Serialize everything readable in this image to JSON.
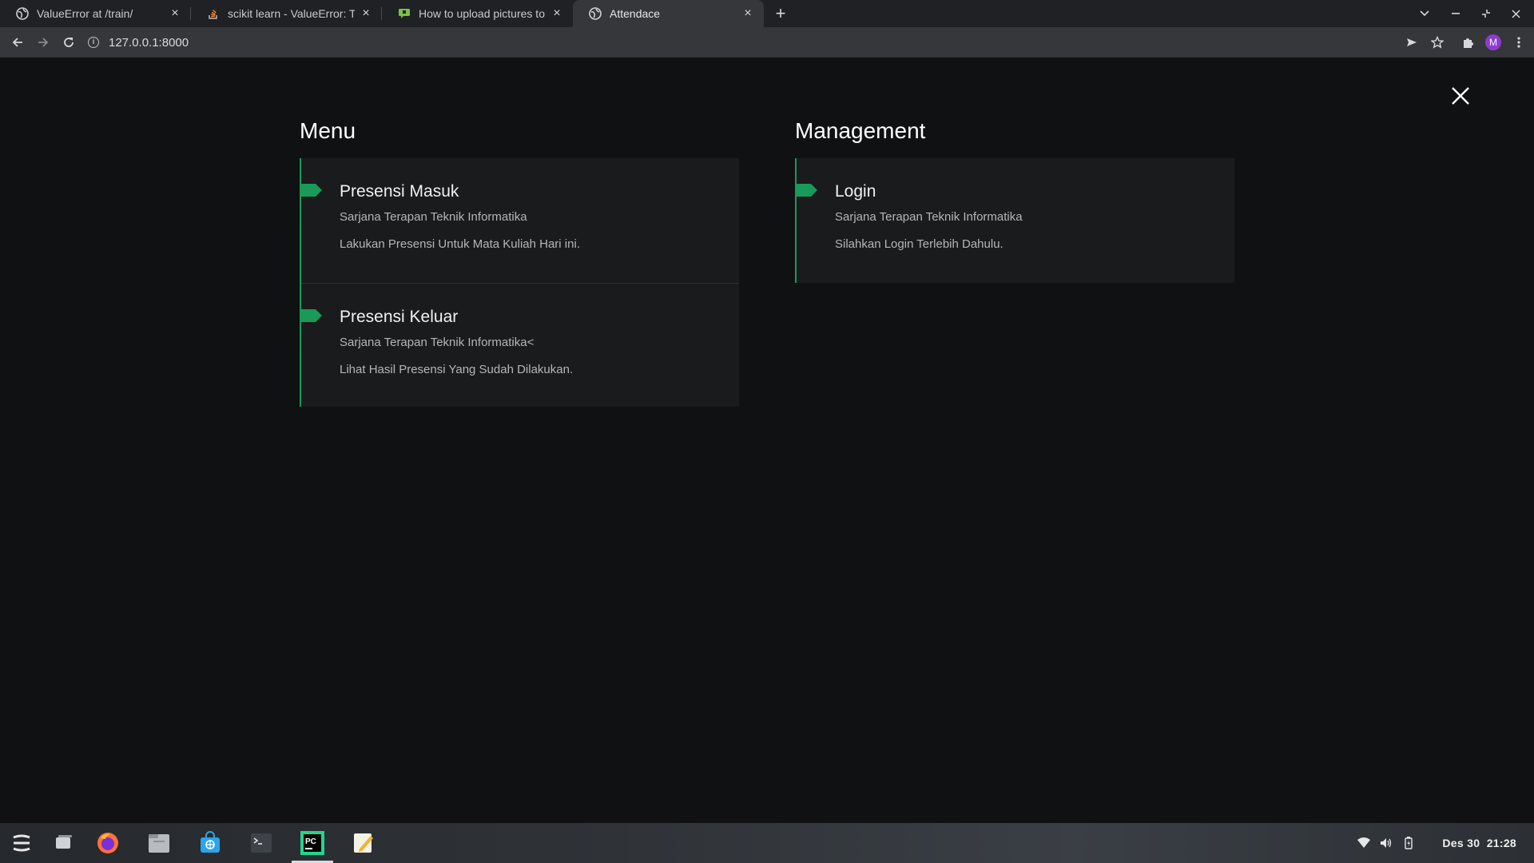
{
  "browser": {
    "tabs": [
      {
        "title": "ValueError at /train/",
        "icon": "globe-icon"
      },
      {
        "title": "scikit learn - ValueError: The",
        "icon": "stackoverflow-icon"
      },
      {
        "title": "How to upload pictures to r",
        "icon": "chat-icon"
      },
      {
        "title": "Attendace",
        "icon": "globe-icon"
      }
    ],
    "url": "127.0.0.1:8000",
    "profile_initial": "M"
  },
  "page": {
    "menu": {
      "title": "Menu",
      "items": [
        {
          "title": "Presensi Masuk",
          "subtitle": "Sarjana Terapan Teknik Informatika",
          "description": "Lakukan Presensi Untuk Mata Kuliah Hari ini."
        },
        {
          "title": "Presensi Keluar",
          "subtitle": "Sarjana Terapan Teknik Informatika<",
          "description": "Lihat Hasil Presensi Yang Sudah Dilakukan."
        }
      ]
    },
    "management": {
      "title": "Management",
      "items": [
        {
          "title": "Login",
          "subtitle": "Sarjana Terapan Teknik Informatika",
          "description": "Silahkan Login Terlebih Dahulu."
        }
      ]
    }
  },
  "taskbar": {
    "date": "Des 30",
    "time": "21:28"
  },
  "colors": {
    "accent": "#1a9a58",
    "page_bg": "#101112",
    "card_bg": "#1a1b1c"
  }
}
